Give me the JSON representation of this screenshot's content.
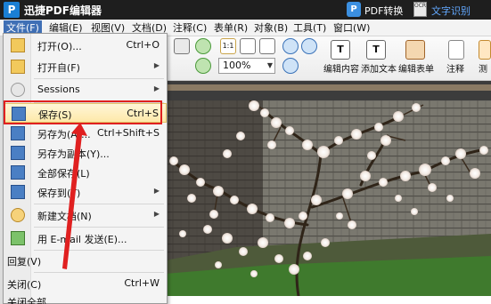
{
  "app": {
    "logo": "P",
    "title": "迅捷PDF编辑器",
    "pdf_convert": "PDF转换",
    "ocr_badge": "OCR",
    "ocr_label": "文字识别"
  },
  "menubar": {
    "items": [
      {
        "label": "文件(F)"
      },
      {
        "label": "编辑(E)"
      },
      {
        "label": "视图(V)"
      },
      {
        "label": "文档(D)"
      },
      {
        "label": "注释(C)"
      },
      {
        "label": "表单(R)"
      },
      {
        "label": "对象(B)"
      },
      {
        "label": "工具(T)"
      },
      {
        "label": "窗口(W)"
      }
    ]
  },
  "toolbar": {
    "zoom_value": "100%",
    "edit_content": "编辑内容",
    "add_text": "添加文本",
    "edit_form": "编辑表单",
    "comment": "注释",
    "measure": "测"
  },
  "file_menu": {
    "items": [
      {
        "label": "打开(O)...",
        "shortcut": "Ctrl+O",
        "icon": "open-folder-icon"
      },
      {
        "label": "打开自(F)",
        "shortcut": "",
        "icon": "open-from-icon",
        "submenu": true
      },
      {
        "label": "Sessions",
        "shortcut": "",
        "icon": "sessions-icon",
        "submenu": true
      },
      {
        "label": "保存(S)",
        "shortcut": "Ctrl+S",
        "icon": "save-icon",
        "highlighted": true
      },
      {
        "label": "另存为(A)...",
        "shortcut": "Ctrl+Shift+S",
        "icon": "save-as-icon"
      },
      {
        "label": "另存为副本(Y)...",
        "shortcut": "",
        "icon": "save-copy-icon"
      },
      {
        "label": "全部保存(L)",
        "shortcut": "",
        "icon": "save-all-icon"
      },
      {
        "label": "保存到(T)",
        "shortcut": "",
        "icon": "save-to-icon",
        "submenu": true
      },
      {
        "label": "新建文档(N)",
        "shortcut": "",
        "icon": "new-document-icon",
        "submenu": true
      },
      {
        "label": "用 E-mail 发送(E)...",
        "shortcut": "",
        "icon": "email-icon"
      },
      {
        "label": "回复(V)",
        "shortcut": "",
        "icon": ""
      },
      {
        "label": "关闭(C)",
        "shortcut": "Ctrl+W",
        "icon": ""
      },
      {
        "label": "关闭全部",
        "shortcut": "",
        "icon": ""
      }
    ]
  },
  "colors": {
    "title_bg": "#1e1e1e",
    "menu_active": "#3f6fb5",
    "highlight_border": "#e02020",
    "ocr_text": "#62a8ff"
  }
}
